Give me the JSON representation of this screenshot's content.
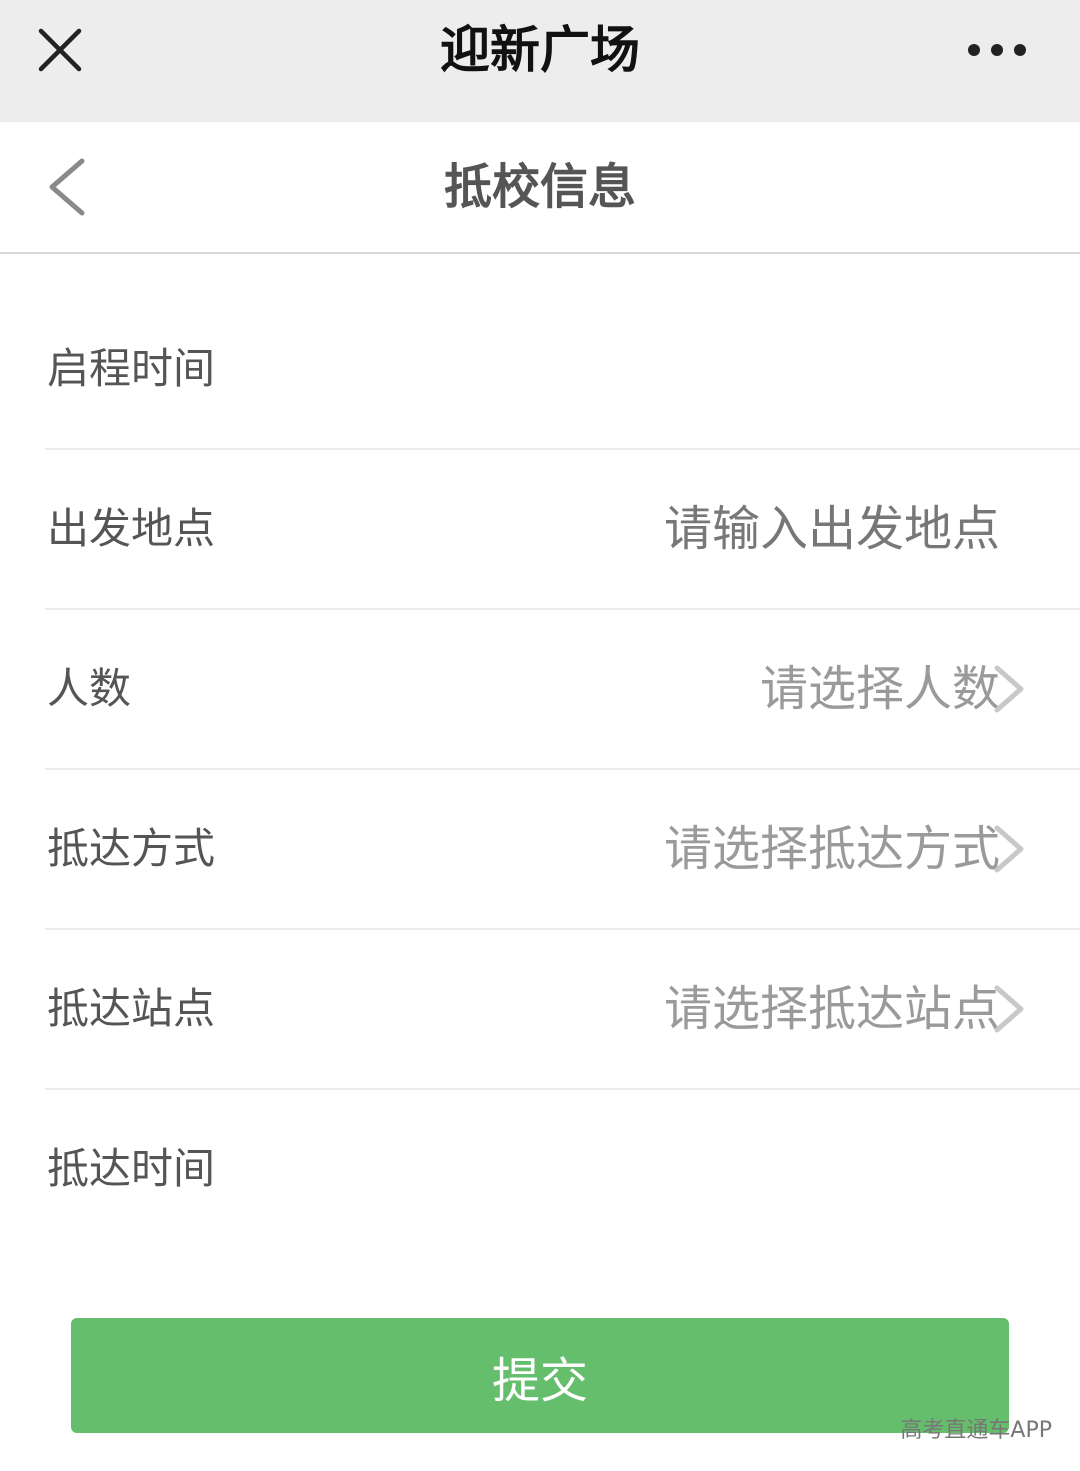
{
  "topbar": {
    "title": "迎新广场",
    "close_icon": "close-icon",
    "more_icon": "more-dots-icon"
  },
  "header": {
    "title": "抵校信息",
    "back_icon": "chevron-left-icon"
  },
  "form": {
    "rows": [
      {
        "label": "启程时间",
        "value": ""
      },
      {
        "label": "出发地点",
        "placeholder": "请输入出发地点"
      },
      {
        "label": "人数",
        "value": "请选择人数"
      },
      {
        "label": "抵达方式",
        "value": "请选择抵达方式"
      },
      {
        "label": "抵达站点",
        "value": "请选择抵达站点"
      },
      {
        "label": "抵达时间",
        "value": ""
      }
    ]
  },
  "submit": {
    "label": "提交"
  },
  "watermark": "高考直通车APP",
  "colors": {
    "topbar_bg": "#ededed",
    "accent_green": "#65be6c",
    "label_text": "#555555",
    "placeholder_text": "#9a9a9a"
  }
}
